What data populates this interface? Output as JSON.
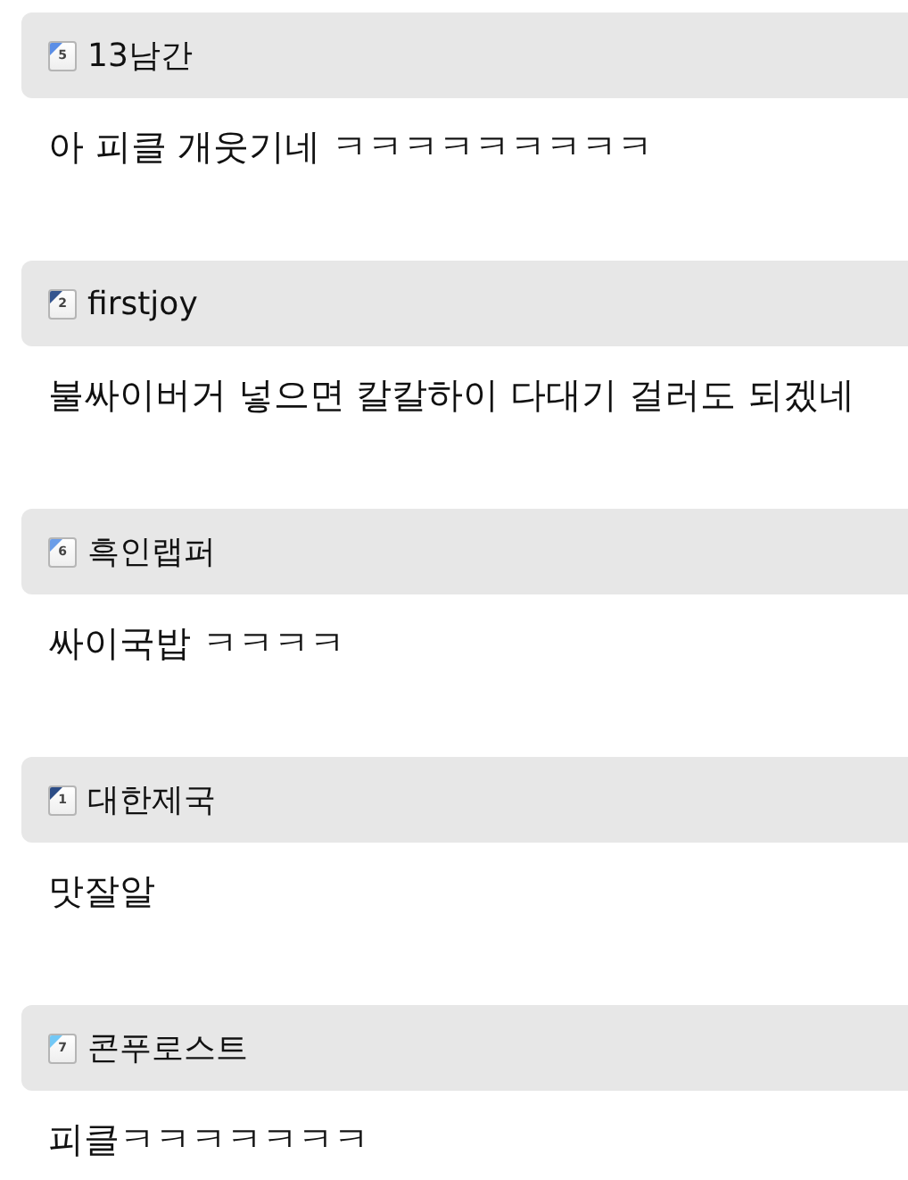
{
  "comments": [
    {
      "level": "5",
      "color": "#5b8ee6",
      "author": "13남간",
      "text": "아 피클 개웃기네 ㅋㅋㅋㅋㅋㅋㅋㅋㅋ"
    },
    {
      "level": "2",
      "color": "#34558f",
      "author": "firstjoy",
      "text": "불싸이버거 넣으면 칼칼하이 다대기 걸러도 되겠네"
    },
    {
      "level": "6",
      "color": "#6b9de8",
      "author": "흑인랩퍼",
      "text": "싸이국밥 ㅋㅋㅋㅋ"
    },
    {
      "level": "1",
      "color": "#2b4c86",
      "author": "대한제국",
      "text": "맛잘알"
    },
    {
      "level": "7",
      "color": "#72c8f6",
      "author": "콘푸로스트",
      "text": "피클ㅋㅋㅋㅋㅋㅋㅋ"
    }
  ]
}
